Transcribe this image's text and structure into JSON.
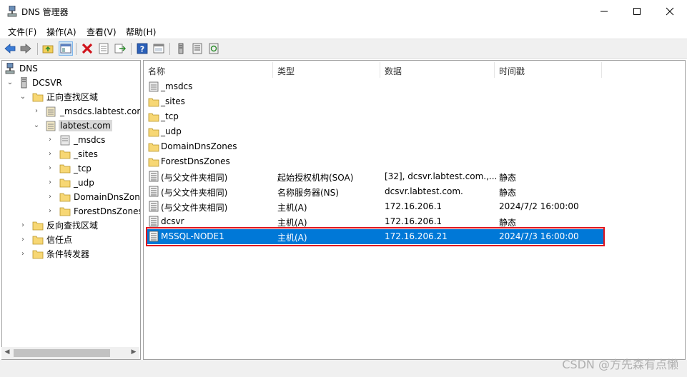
{
  "window": {
    "title": "DNS 管理器"
  },
  "menu": [
    "文件(F)",
    "操作(A)",
    "查看(V)",
    "帮助(H)"
  ],
  "toolbar_icons": [
    "back-icon",
    "forward-icon",
    "up-folder-icon",
    "show-hide-tree-icon",
    "delete-icon",
    "properties-icon",
    "export-icon",
    "help-icon",
    "view-icon",
    "server-icon",
    "list-icon",
    "refresh-icon"
  ],
  "tree": {
    "root": "DNS",
    "server": "DCSVR",
    "forward_zones": "正向查找区域",
    "msdcs_zone": "_msdcs.labtest.com",
    "labtest_zone": "labtest.com",
    "labtest_children": [
      "_msdcs",
      "_sites",
      "_tcp",
      "_udp",
      "DomainDnsZones",
      "ForestDnsZones"
    ],
    "reverse_zones": "反向查找区域",
    "trust_points": "信任点",
    "conditional_forwarders": "条件转发器"
  },
  "columns": {
    "name": "名称",
    "type": "类型",
    "data": "数据",
    "timestamp": "时间戳"
  },
  "rows": [
    {
      "icon": "zone-folder-icon",
      "name": "_msdcs",
      "type": "",
      "data": "",
      "timestamp": ""
    },
    {
      "icon": "folder-icon",
      "name": "_sites",
      "type": "",
      "data": "",
      "timestamp": ""
    },
    {
      "icon": "folder-icon",
      "name": "_tcp",
      "type": "",
      "data": "",
      "timestamp": ""
    },
    {
      "icon": "folder-icon",
      "name": "_udp",
      "type": "",
      "data": "",
      "timestamp": ""
    },
    {
      "icon": "folder-icon",
      "name": "DomainDnsZones",
      "type": "",
      "data": "",
      "timestamp": ""
    },
    {
      "icon": "folder-icon",
      "name": "ForestDnsZones",
      "type": "",
      "data": "",
      "timestamp": ""
    },
    {
      "icon": "record-icon",
      "name": "(与父文件夹相同)",
      "type": "起始授权机构(SOA)",
      "data": "[32], dcsvr.labtest.com.,...",
      "timestamp": "静态"
    },
    {
      "icon": "record-icon",
      "name": "(与父文件夹相同)",
      "type": "名称服务器(NS)",
      "data": "dcsvr.labtest.com.",
      "timestamp": "静态"
    },
    {
      "icon": "record-icon",
      "name": "(与父文件夹相同)",
      "type": "主机(A)",
      "data": "172.16.206.1",
      "timestamp": "2024/7/2 16:00:00"
    },
    {
      "icon": "record-icon",
      "name": "dcsvr",
      "type": "主机(A)",
      "data": "172.16.206.1",
      "timestamp": "静态"
    },
    {
      "icon": "record-icon",
      "name": "MSSQL-NODE1",
      "type": "主机(A)",
      "data": "172.16.206.21",
      "timestamp": "2024/7/3 16:00:00",
      "selected": true
    }
  ],
  "watermark": "CSDN @方先森有点懒",
  "colors": {
    "selection": "#0078d7",
    "highlight_box": "#e0141e",
    "folder": "#f7d774"
  }
}
